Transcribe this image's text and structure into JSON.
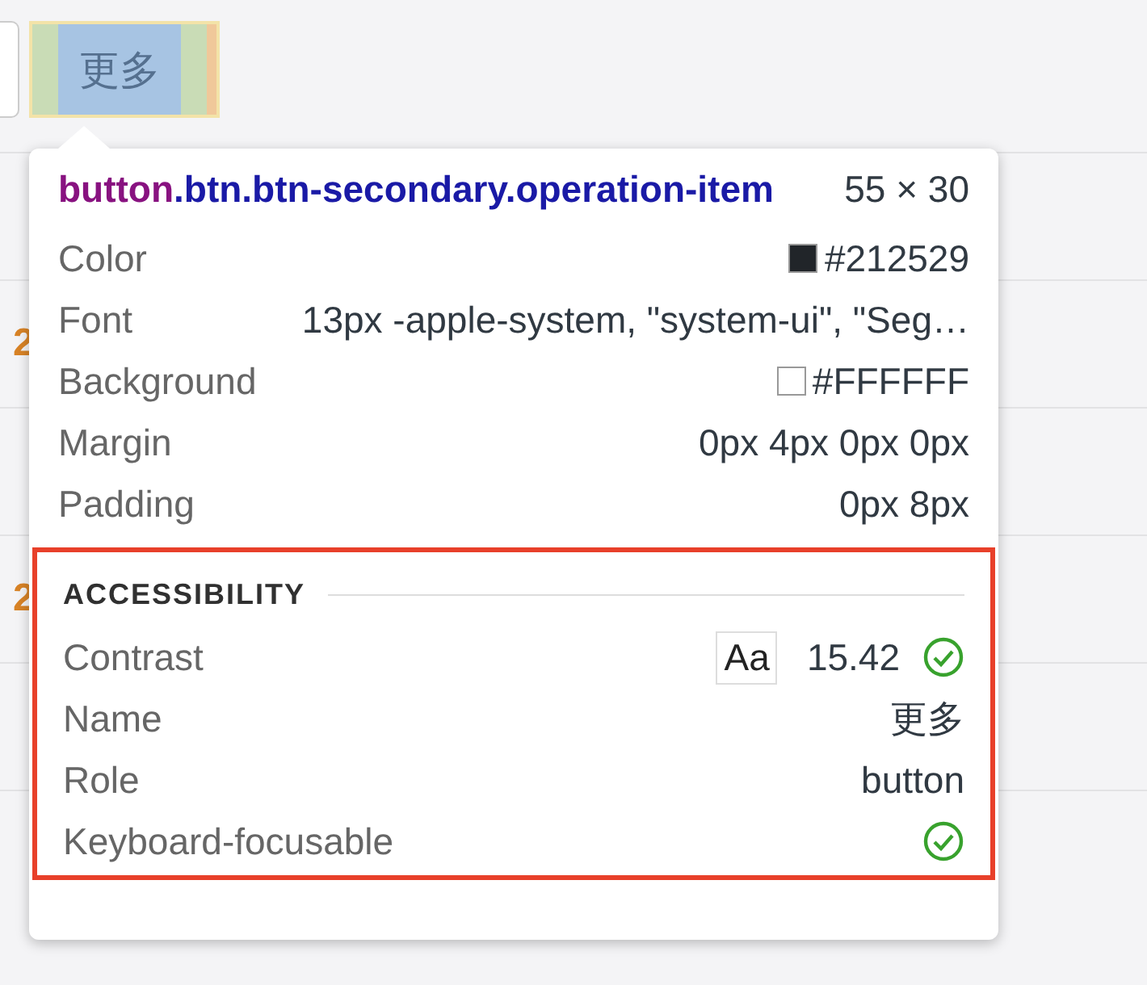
{
  "highlighted_button": {
    "label": "更多"
  },
  "background_rows": [
    {
      "cell": ""
    },
    {
      "cell": "2"
    },
    {
      "cell": ""
    },
    {
      "cell": "2"
    },
    {
      "cell": ""
    }
  ],
  "tooltip": {
    "tag": "button",
    "classes": ".btn.btn-secondary.operation-item",
    "size": "55 × 30",
    "properties": [
      {
        "label": "Color",
        "value": "#212529",
        "swatch": true
      },
      {
        "label": "Font",
        "value": "13px -apple-system, \"system-ui\", \"Seg…",
        "swatch": false
      },
      {
        "label": "Background",
        "value": "#FFFFFF",
        "swatch": true
      },
      {
        "label": "Margin",
        "value": "0px 4px 0px 0px",
        "swatch": false
      },
      {
        "label": "Padding",
        "value": "0px 8px",
        "swatch": false
      }
    ],
    "accessibility": {
      "title": "ACCESSIBILITY",
      "rows": [
        {
          "kind": "contrast",
          "label": "Contrast",
          "sample": "Aa",
          "value": "15.42",
          "passed": true
        },
        {
          "kind": "text",
          "label": "Name",
          "value": "更多"
        },
        {
          "kind": "text",
          "label": "Role",
          "value": "button"
        },
        {
          "kind": "check",
          "label": "Keyboard-focusable",
          "passed": true
        }
      ]
    }
  }
}
